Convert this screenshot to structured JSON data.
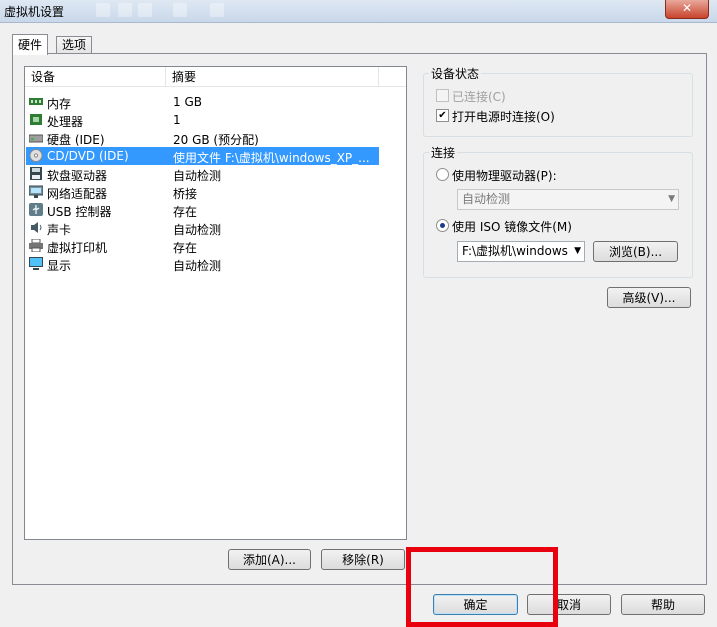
{
  "window": {
    "title": "虚拟机设置",
    "close_label": "✕"
  },
  "tabs": [
    {
      "label": "硬件",
      "active": true
    },
    {
      "label": "选项",
      "active": false
    }
  ],
  "device_list": {
    "columns": [
      "设备",
      "摘要"
    ],
    "rows": [
      {
        "name": "内存",
        "summary": "1 GB",
        "icon": "memory-icon"
      },
      {
        "name": "处理器",
        "summary": "1",
        "icon": "processor-icon"
      },
      {
        "name": "硬盘 (IDE)",
        "summary": "20 GB (预分配)",
        "icon": "hard-disk-icon"
      },
      {
        "name": "CD/DVD (IDE)",
        "summary": "使用文件 F:\\虚拟机\\windows_XP_...",
        "icon": "cd-dvd-icon",
        "selected": true
      },
      {
        "name": "软盘驱动器",
        "summary": "自动检测",
        "icon": "floppy-icon"
      },
      {
        "name": "网络适配器",
        "summary": "桥接",
        "icon": "network-adapter-icon"
      },
      {
        "name": "USB 控制器",
        "summary": "存在",
        "icon": "usb-icon"
      },
      {
        "name": "声卡",
        "summary": "自动检测",
        "icon": "sound-card-icon"
      },
      {
        "name": "虚拟打印机",
        "summary": "存在",
        "icon": "printer-icon"
      },
      {
        "name": "显示",
        "summary": "自动检测",
        "icon": "display-icon"
      }
    ]
  },
  "list_buttons": {
    "add": "添加(A)...",
    "remove": "移除(R)"
  },
  "device_status": {
    "title": "设备状态",
    "connected": {
      "label": "已连接(C)",
      "checked": false,
      "disabled": true
    },
    "connect_at_power_on": {
      "label": "打开电源时连接(O)",
      "checked": true
    }
  },
  "connection": {
    "title": "连接",
    "physical": {
      "label": "使用物理驱动器(P):",
      "selected": false
    },
    "physical_select": {
      "value": "自动检测"
    },
    "iso": {
      "label": "使用 ISO 镜像文件(M)",
      "selected": true
    },
    "iso_path": {
      "value": "F:\\虚拟机\\windows"
    },
    "browse": "浏览(B)..."
  },
  "advanced": "高级(V)...",
  "footer": {
    "ok": "确定",
    "cancel": "取消",
    "help": "帮助"
  },
  "colors": {
    "selection": "#3399ff",
    "highlight_box": "#e8000e"
  }
}
